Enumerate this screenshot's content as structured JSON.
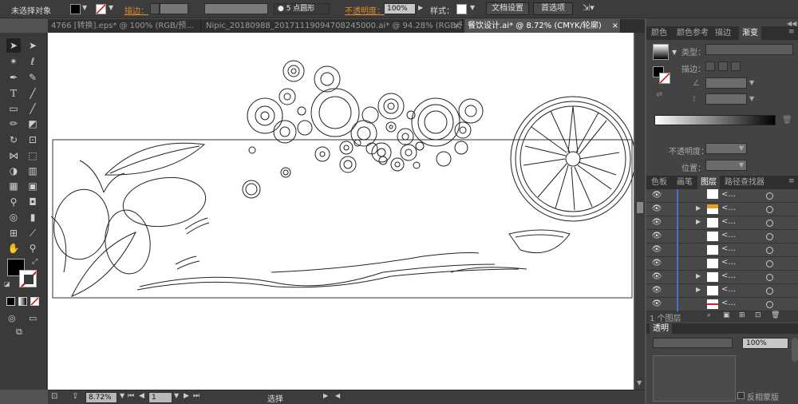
{
  "control_bar": {
    "selection": "未选择对象",
    "stroke_label": "描边：",
    "brush": "5 点圆形",
    "opacity_label": "不透明度：",
    "opacity_value": "100%",
    "style_label": "样式：",
    "doc_settings": "文档设置",
    "preferences": "首选项",
    "stroke_color": "#cc6600"
  },
  "tabs": [
    {
      "label": "4766 [转换].eps* @ 100% (RGB/预..."
    },
    {
      "label": "Nipic_20180988_20171119094708245000.ai* @ 94.28% (RGB/预..."
    },
    {
      "label": "餐饮设计.ai* @ 8.72% (CMYK/轮廓)"
    }
  ],
  "tools": [
    "selection-tool",
    "direct-selection-tool",
    "magic-wand-tool",
    "lasso-tool",
    "pen-tool",
    "curvature-tool",
    "type-tool",
    "line-tool",
    "rectangle-tool",
    "paintbrush-tool",
    "pencil-tool",
    "eraser-tool",
    "rotate-tool",
    "scale-tool",
    "width-tool",
    "free-transform-tool",
    "shape-builder-tool",
    "perspective-grid-tool",
    "mesh-tool",
    "gradient-tool",
    "eyedropper-tool",
    "blend-tool",
    "symbol-sprayer-tool",
    "column-graph-tool",
    "artboard-tool",
    "slice-tool",
    "hand-tool",
    "zoom-tool"
  ],
  "status": {
    "zoom": "8.72%",
    "page": "1",
    "mode": "选择"
  },
  "gradient_panel": {
    "tabs": [
      "颜色",
      "颜色参考",
      "描边",
      "渐变"
    ],
    "type_label": "类型：",
    "stroke_label": "描边：",
    "opacity_label": "不透明度：",
    "location_label": "位置："
  },
  "layers_panel": {
    "tabs": [
      "色板",
      "画笔",
      "图层",
      "路径查找器"
    ],
    "count": "1 个图层",
    "row_count": 8,
    "rows": [
      {
        "thumb": "#ffffff"
      },
      {
        "thumb": "#e0a020"
      },
      {
        "thumb": "#ffffff"
      },
      {
        "thumb": "#ffffff"
      },
      {
        "thumb": "#ffffff"
      },
      {
        "thumb": "#ffffff"
      },
      {
        "thumb": "#ffffff"
      },
      {
        "thumb": "#cc2222"
      }
    ],
    "row_label": "<..."
  },
  "transparency_panel": {
    "title": "透明",
    "opacity": "100%",
    "invert_mask": "反相蒙版"
  }
}
